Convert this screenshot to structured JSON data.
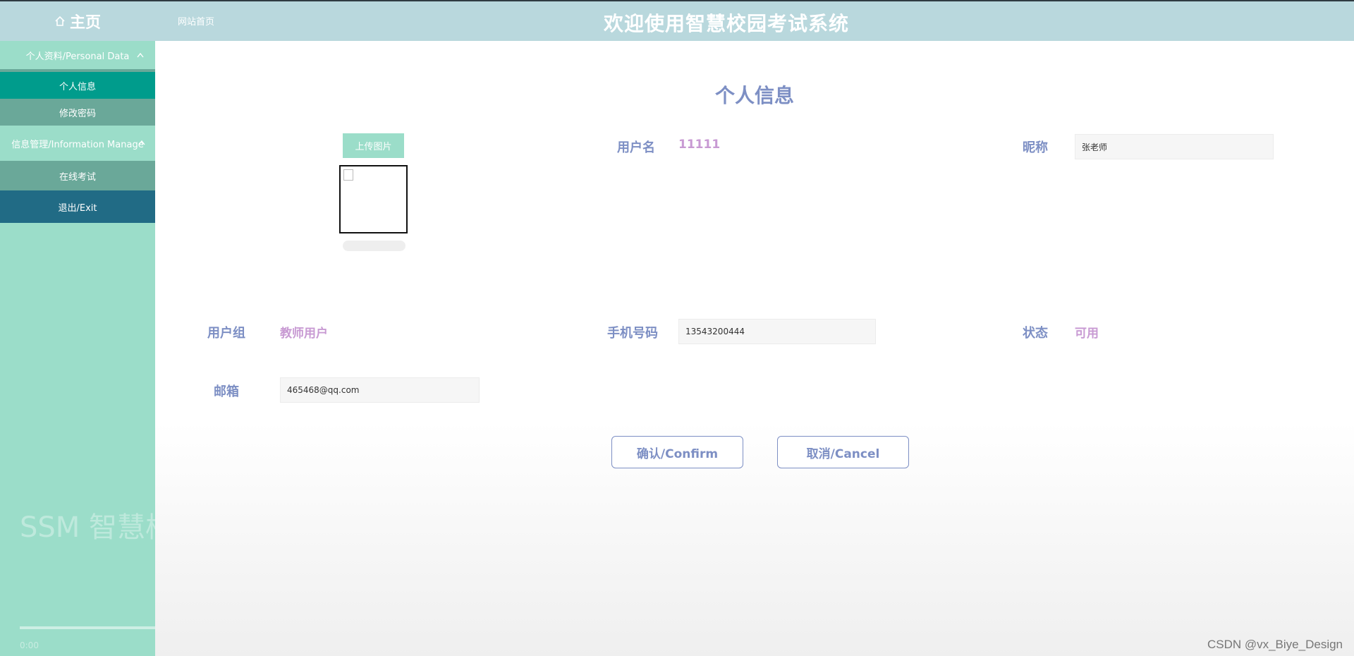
{
  "header": {
    "home_label": "主页",
    "site_link": "网站首页",
    "system_title": "欢迎使用智慧校园考试系统"
  },
  "sidebar": {
    "group1": "个人资料/Personal Data",
    "items1": [
      {
        "label": "个人信息",
        "active": true
      },
      {
        "label": "修改密码",
        "active": false
      }
    ],
    "group2": "信息管理/Information Manage",
    "items2": [
      {
        "label": "在线考试"
      }
    ],
    "exit": "退出/Exit",
    "ghost_text": "SSM 智慧校园考试系统",
    "time": "0:00"
  },
  "page": {
    "title": "个人信息",
    "upload_label": "上传图片"
  },
  "form": {
    "username_label": "用户名",
    "username_value": "11111",
    "nickname_label": "昵称",
    "nickname_value": "张老师",
    "group_label": "用户组",
    "group_value": "教师用户",
    "phone_label": "手机号码",
    "phone_value": "13543200444",
    "status_label": "状态",
    "status_value": "可用",
    "email_label": "邮箱",
    "email_value": "465468@qq.com"
  },
  "buttons": {
    "confirm": "确认/Confirm",
    "cancel": "取消/Cancel"
  },
  "watermark": "CSDN @vx_Biye_Design",
  "colors": {
    "header_bg": "#b9d8dd",
    "sidebar_bg": "#9bddc9",
    "active_item": "#009c8c",
    "exit_item": "#216b85",
    "label": "#7d8fc4",
    "value": "#c89ad3"
  }
}
